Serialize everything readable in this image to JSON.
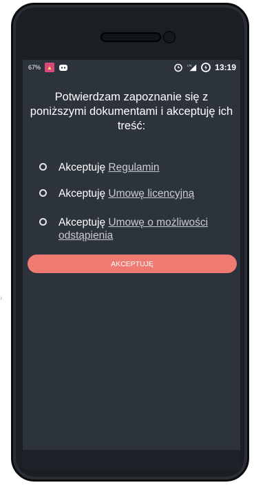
{
  "statusbar": {
    "battery_percent": "67%",
    "time": "13:19",
    "network": "LTE"
  },
  "screen": {
    "title": "Potwierdzam zapoznanie się z poniższymi dokumentami i akceptuję ich treść:",
    "options": [
      {
        "prefix": "Akceptuję ",
        "link": "Regulamin"
      },
      {
        "prefix": "Akceptuję ",
        "link": "Umowę licencyjną"
      },
      {
        "prefix": "Akceptuję ",
        "link": "Umowę o możliwości odstąpienia"
      }
    ],
    "accept_label": "AKCEPTUJĘ"
  },
  "colors": {
    "screen_bg": "#2c333d",
    "button_bg": "#ef7a72",
    "text": "#ffffff",
    "link": "#c9cdd2"
  }
}
